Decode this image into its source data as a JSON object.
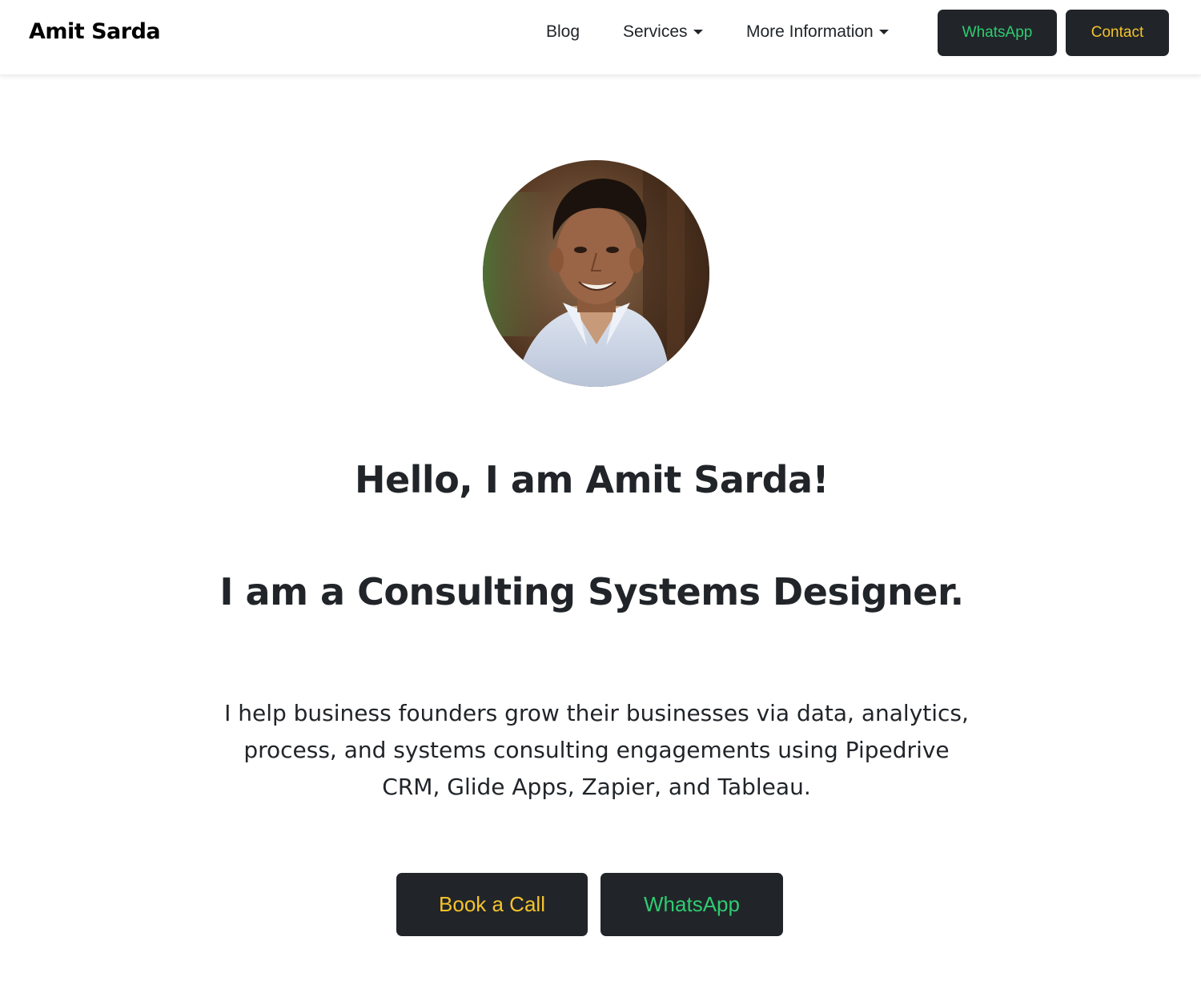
{
  "navbar": {
    "brand": "Amit Sarda",
    "links": {
      "blog": "Blog",
      "services": "Services",
      "more_information": "More Information"
    },
    "buttons": {
      "whatsapp": "WhatsApp",
      "contact": "Contact"
    }
  },
  "hero": {
    "greeting": "Hello, I am Amit Sarda!",
    "role": "I am a Consulting Systems Designer.",
    "description": "I help business founders grow their businesses via data, analytics, process, and systems consulting engagements using Pipedrive CRM, Glide Apps, Zapier, and Tableau.",
    "buttons": {
      "book_call": "Book a Call",
      "whatsapp": "WhatsApp"
    }
  },
  "colors": {
    "button_bg": "#212529",
    "whatsapp_text": "#2ecc71",
    "accent_yellow": "#f5c22b",
    "text": "#212529"
  }
}
